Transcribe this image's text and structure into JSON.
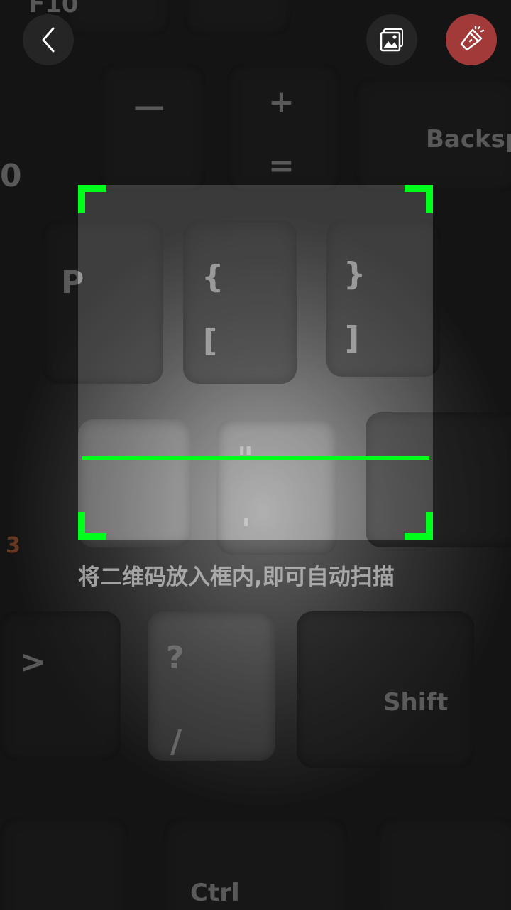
{
  "header": {
    "back_icon": "chevron-left-icon",
    "gallery_icon": "image-gallery-icon",
    "flashlight_icon": "flashlight-icon"
  },
  "colors": {
    "scan_accent": "#00ff1a",
    "flashlight_button": "#a33a3a",
    "button_background": "#2a2a2a"
  },
  "scanner": {
    "hint": "将二维码放入框内,即可自动扫描"
  },
  "camera_preview": {
    "visible_key_labels": [
      "F10",
      "—",
      "+",
      "=",
      "Backsp",
      "0",
      "P",
      "{",
      "[",
      "}",
      "]",
      "\"",
      "'",
      "3",
      ">",
      "?",
      "/",
      "Shift",
      "Ctrl"
    ]
  }
}
